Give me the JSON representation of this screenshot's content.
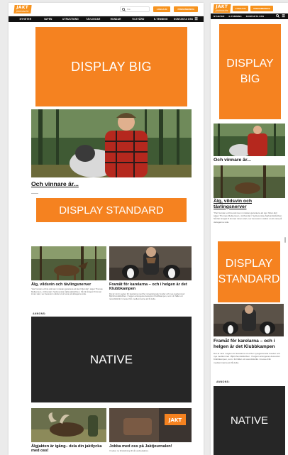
{
  "brand": {
    "logo_text": "JAKT",
    "logo_sub": "JOURNALEN",
    "accent": "#f58220",
    "dark": "#262626"
  },
  "desktop": {
    "search_placeholder": "Sök",
    "login_label": "LOGGA IN",
    "subscribe_label": "PRENUMERERA",
    "nav": [
      "NYHETER",
      "VAPEN",
      "UTRUSTNING",
      "TÄVLINGAR",
      "HUNDAR",
      "VILTVÅRD",
      "E-TEMNING",
      "KONTAKTA OSS"
    ],
    "ad_big": "DISPLAY BIG",
    "hero_title": "Och vinnare är...",
    "ad_standard": "DISPLAY STANDARD",
    "articles": [
      {
        "title": "Älg, vildsvin och tävlingsnerver",
        "excerpt": "\"Har hunden ett bra sök kan vi nästan garantera att den hittar älg\", säger Thomas Melkersson, vinthundar i Sydsvenska Älghundsklubben. Så här knappt 8 timmar innan start, ser dessutom vädret ut att vara på deltagarna sida."
      },
      {
        "title": "Framåt för karelarna – och i helgen är det Klubbkampen",
        "excerpt": "Det är vind i seglen för karelarna med fler nyregistrerade hundar och nya medlemmar i Björnhundsklubben. I helgen arrangeras dessutom Klubbkampen, som i år håller ett rekorddistrikt. Inresse från medlemmarna att få delta."
      }
    ],
    "annons_label": "ANNONS:",
    "ad_native": "NATIVE",
    "bottom_articles": [
      {
        "title": "Älgjakten är igång– dela din jaktlycka med oss!"
      },
      {
        "title": "Jobba med oss på Jaktjournalen!",
        "excerpt": "Vi söker nu förstärkning till vår webredaktion."
      }
    ]
  },
  "mobile": {
    "login_label": "LOGGA IN",
    "subscribe_label": "PRENUMERERA",
    "nav": [
      "NYHETER",
      "E-TEMNING",
      "KONTAKTA OSS"
    ],
    "ad_big": "DISPLAY BIG",
    "hero_title": "Och vinnare är...",
    "article1": {
      "title": "Älg, vildsvin och tävlingsnerver",
      "excerpt": "\"Har hunden ett bra sök kan vi nästan garantera att den hittar älg\", säger Thomas Melkersson, vinthundar i Sydsvenska Älghundsklubben. Så här knappt 8 timmar innan start, ser dessutom vädret ut att vara på deltagarna sida."
    },
    "ad_standard": "DISPLAY STANDARD",
    "article2": {
      "title": "Framåt för karelarna – och i helgen är det Klubbkampen",
      "excerpt": "Det är vind i seglen för karelarna med fler nyregistrerade hundar och nya medlemmar i Björnhundsklubben. I helgen arrangeras dessutom Klubbkampen, som i år håller ett rekorddistrikt. Inresse från medlemmarna att få delta."
    },
    "annons_label": "ANNONS:",
    "ad_native": "NATIVE"
  }
}
